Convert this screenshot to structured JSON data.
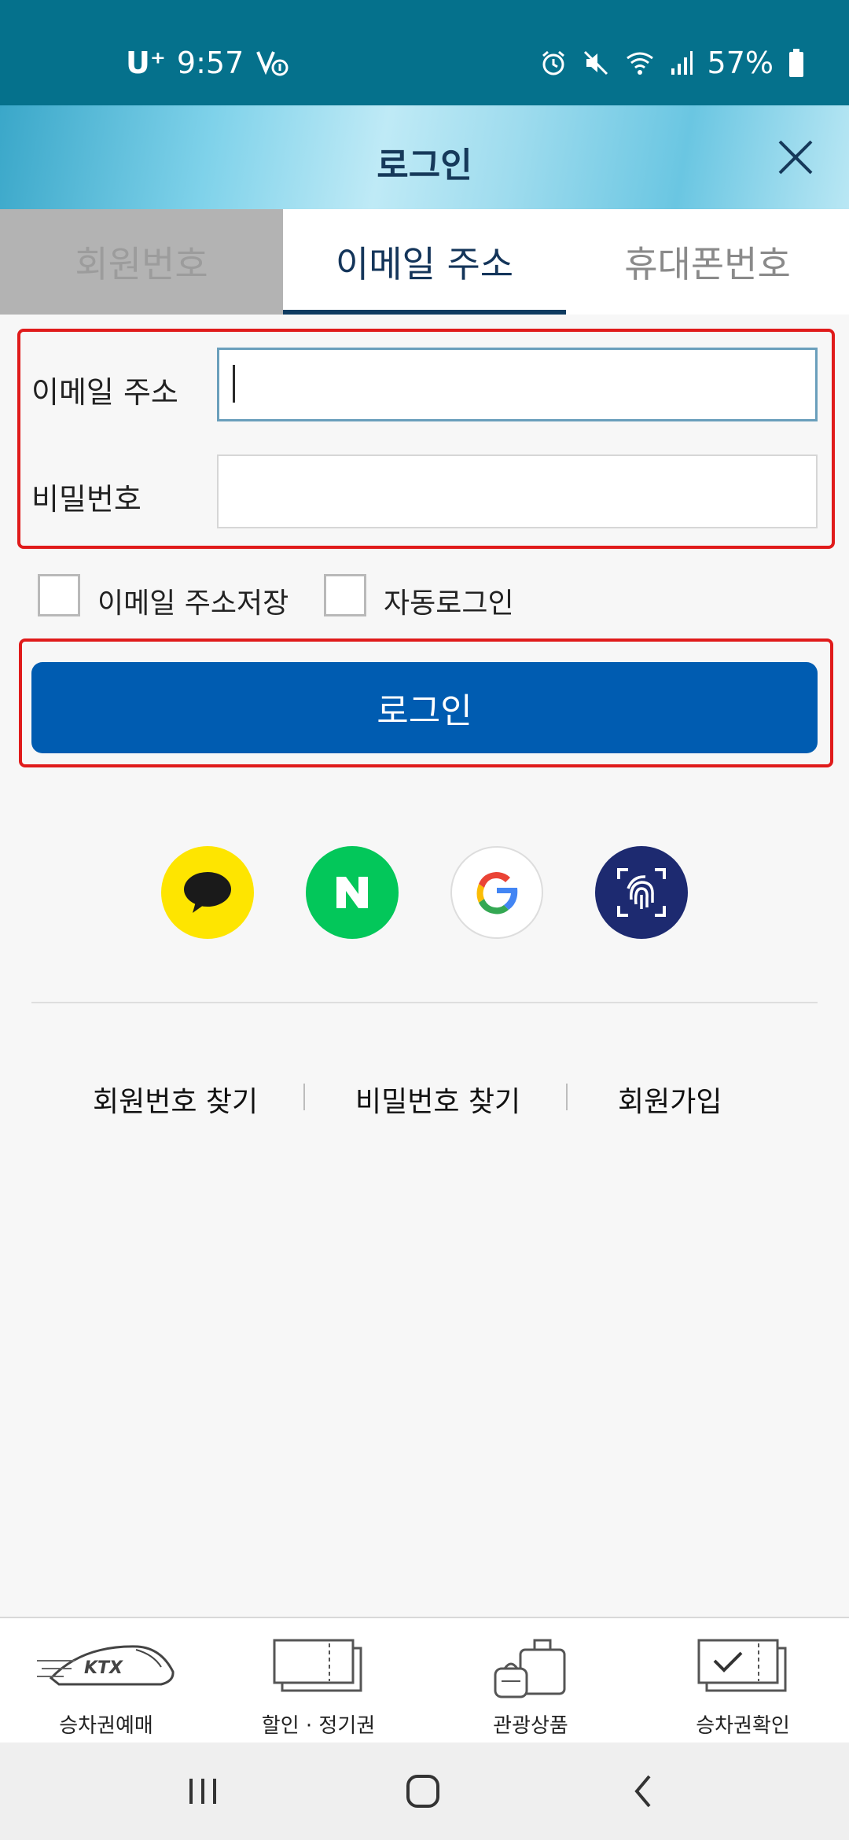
{
  "status_bar": {
    "carrier": "U⁺",
    "time": "9:57",
    "battery": "57%"
  },
  "header": {
    "title": "로그인"
  },
  "tabs": [
    {
      "label": "회원번호"
    },
    {
      "label": "이메일 주소"
    },
    {
      "label": "휴대폰번호"
    }
  ],
  "form": {
    "email_label": "이메일 주소",
    "email_value": "",
    "password_label": "비밀번호",
    "password_value": ""
  },
  "options": {
    "save_email_label": "이메일 주소저장",
    "auto_login_label": "자동로그인"
  },
  "login_button": "로그인",
  "links": {
    "find_member_number": "회원번호 찾기",
    "find_password": "비밀번호 찾기",
    "sign_up": "회원가입"
  },
  "bottom_nav": [
    {
      "label": "승차권예매"
    },
    {
      "label": "할인 · 정기권"
    },
    {
      "label": "관광상품"
    },
    {
      "label": "승차권확인"
    }
  ],
  "colors": {
    "status_bar": "#05718c",
    "primary_button": "#005cb1",
    "highlight_border": "#e01b1b",
    "kakao": "#fee500",
    "naver": "#03c75a",
    "fingerprint": "#1d2a70"
  },
  "icons": [
    "close-icon",
    "kakao-icon",
    "naver-icon",
    "google-icon",
    "fingerprint-icon",
    "ktx-train-icon",
    "tickets-icon",
    "luggage-icon",
    "ticket-check-icon"
  ]
}
